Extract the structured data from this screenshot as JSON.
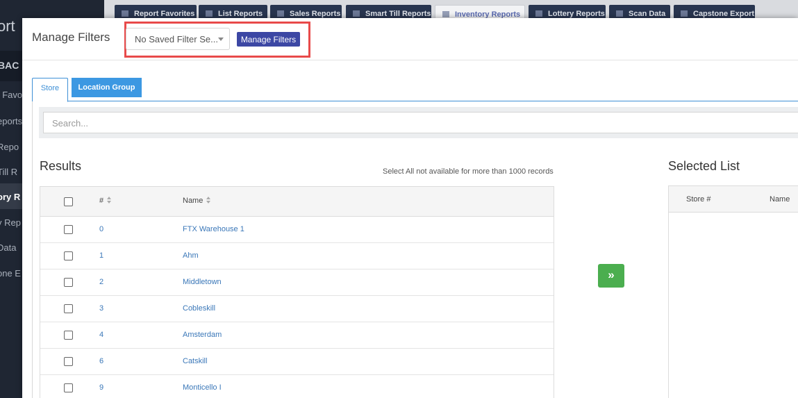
{
  "background": {
    "brand_fragment": "ort",
    "section_fragment": "BAC",
    "sidebar_items": [
      "t Favo",
      "eports",
      "Repo",
      "Till R",
      "ory R",
      "y Rep",
      "Data",
      "one E"
    ],
    "top_tabs": [
      "Report Favorites",
      "List Reports",
      "Sales Reports",
      "Smart Till Reports",
      "Inventory Reports",
      "Lottery Reports",
      "Scan Data",
      "Capstone Export"
    ]
  },
  "modal": {
    "title": "Manage Filters",
    "saved_filter_select": "No Saved Filter Se...",
    "manage_filters_button": "Manage Filters"
  },
  "tabs": {
    "store": "Store",
    "location_group": "Location Group"
  },
  "search": {
    "placeholder": "Search..."
  },
  "results": {
    "title": "Results",
    "note": "Select All not available for more than 1000 records",
    "columns": [
      "#",
      "Name"
    ],
    "rows": [
      {
        "num": "0",
        "name": "FTX Warehouse 1"
      },
      {
        "num": "1",
        "name": "Ahm"
      },
      {
        "num": "2",
        "name": "Middletown"
      },
      {
        "num": "3",
        "name": "Cobleskill"
      },
      {
        "num": "4",
        "name": "Amsterdam"
      },
      {
        "num": "6",
        "name": "Catskill"
      },
      {
        "num": "9",
        "name": "Monticello I"
      }
    ]
  },
  "move_button": "»",
  "selected": {
    "title": "Selected List",
    "columns": [
      "Store #",
      "Name"
    ]
  },
  "colors": {
    "accent_blue": "#3d8fd6",
    "manage_btn": "#3c47a4",
    "move_btn_green": "#4bae4f",
    "highlight_red": "#e84a4a"
  }
}
